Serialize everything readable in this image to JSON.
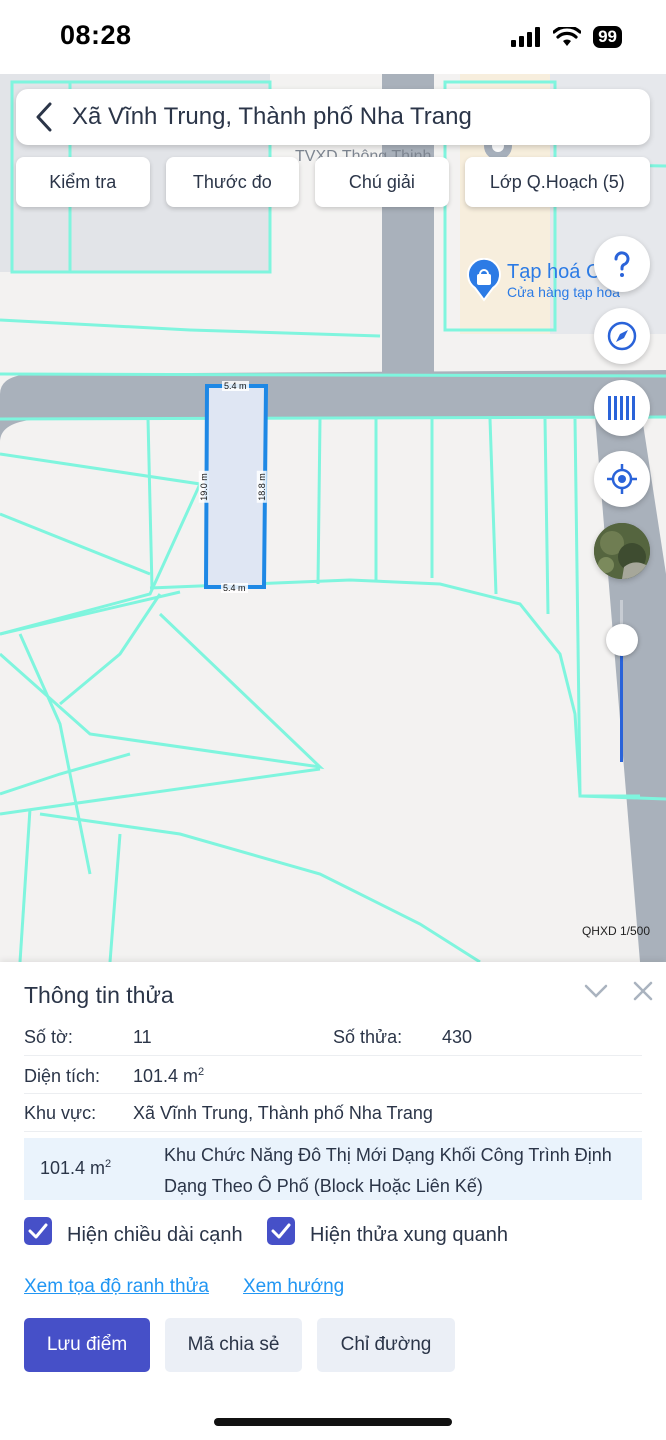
{
  "status_bar": {
    "time": "08:28",
    "battery": "99"
  },
  "search": {
    "title": "Xã Vĩnh Trung, Thành phố Nha Trang"
  },
  "chips": [
    "Kiểm tra",
    "Thước đo",
    "Chú giải",
    "Lớp Q.Hoạch (5)"
  ],
  "map": {
    "poi_name": "Tạp hoá C",
    "poi_sub": "Cửa hàng tạp hoá",
    "faded_label": "TVXD Thông Thịnh",
    "parcel_dims": {
      "top": "5.4 m",
      "bottom": "5.4 m",
      "left": "19.0 m",
      "right": "18.8 m"
    },
    "scale": "QHXD 1/500",
    "zoom_level_fraction": 0.75
  },
  "icons": {
    "back": "chevron-left-icon",
    "help": "question-icon",
    "compass": "compass-icon",
    "layers": "barcode-icon",
    "locate": "locate-icon",
    "satellite": "satellite-thumbnail"
  },
  "sheet": {
    "title": "Thông tin thửa",
    "so_to_label": "Số tờ:",
    "so_to_value": "11",
    "so_thua_label": "Số thửa:",
    "so_thua_value": "430",
    "dien_tich_label": "Diện tích:",
    "dien_tich_value": "101.4 m",
    "dien_tich_unit_sup": "2",
    "khu_vuc_label": "Khu vực:",
    "khu_vuc_value": "Xã Vĩnh Trung, Thành phố Nha Trang",
    "zone_area": "101.4 m",
    "zone_area_sup": "2",
    "zone_desc": "Khu Chức Năng Đô Thị Mới Dạng Khối Công Trình Định Dạng Theo Ô Phố (Block Hoặc Liên Kế)",
    "check1_label": "Hiện chiều dài cạnh",
    "check2_label": "Hiện thửa xung quanh",
    "link1": "Xem tọa độ ranh thửa",
    "link2": "Xem hướng",
    "btn_save": "Lưu điểm",
    "btn_share": "Mã chia sẻ",
    "btn_direction": "Chỉ đường"
  },
  "colors": {
    "accent": "#4650c8",
    "link": "#2196f3",
    "parcel": "#1e88e5",
    "boundary": "#7ff5de",
    "road": "#a9b1bb"
  }
}
